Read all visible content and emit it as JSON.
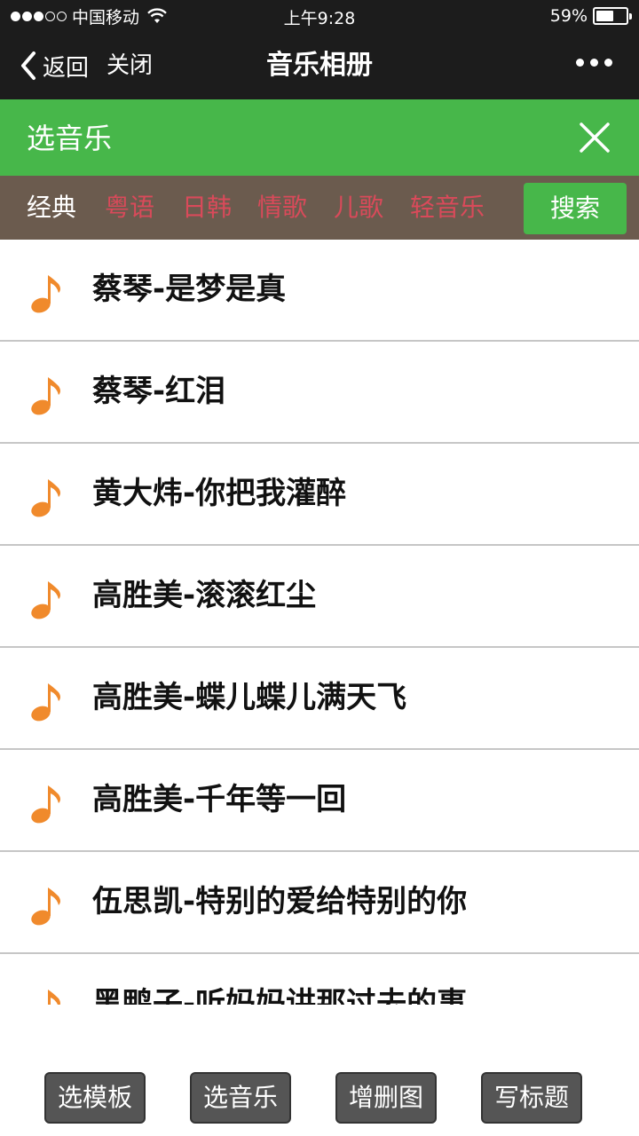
{
  "status_bar": {
    "carrier": "中国移动",
    "time": "上午9:28",
    "battery": "59%",
    "battery_level": 0.59
  },
  "nav": {
    "back_label": "返回",
    "close_label": "关闭",
    "title": "音乐相册"
  },
  "picker": {
    "title": "选音乐"
  },
  "categories": [
    "经典",
    "粤语",
    "日韩",
    "情歌",
    "儿歌",
    "轻音乐"
  ],
  "search_label": "搜索",
  "songs": [
    "蔡琴-是梦是真",
    "蔡琴-红泪",
    "黄大炜-你把我灌醉",
    "高胜美-滚滚红尘",
    "高胜美-蝶儿蝶儿满天飞",
    "高胜美-千年等一回",
    "伍思凯-特别的爱给特别的你",
    "黑鸭子-听妈妈讲那过去的事"
  ],
  "toolbar": {
    "template_label": "选模板",
    "music_label": "选音乐",
    "images_label": "增删图",
    "caption_label": "写标题"
  },
  "colors": {
    "accent_green": "#47b74a",
    "category_active": "#ffffff",
    "category_inactive": "#d94a5a",
    "note_orange": "#f08a2c"
  }
}
